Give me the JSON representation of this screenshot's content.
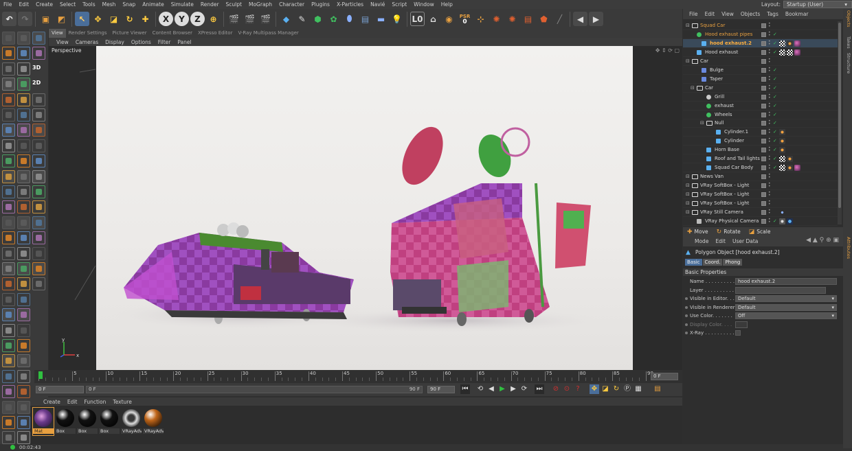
{
  "menubar": {
    "items": [
      "File",
      "Edit",
      "Create",
      "Select",
      "Tools",
      "Mesh",
      "Snap",
      "Animate",
      "Simulate",
      "Render",
      "Sculpt",
      "MoGraph",
      "Character",
      "Plugins",
      "X-Particles",
      "Navié",
      "Script",
      "Window",
      "Help"
    ],
    "layout_label": "Layout:",
    "layout_value": "Startup (User)"
  },
  "toolbar": {
    "axis_labels": [
      "X",
      "Y",
      "Z"
    ],
    "psr_label": "PSR",
    "psr_value": "0",
    "arrow_left": "◀",
    "arrow_right": "▶"
  },
  "left_toolbar": {
    "mode_3d": "3D",
    "mode_2d": "2D"
  },
  "viewport_tabs": [
    "View",
    "Render Settings",
    "Picture Viewer",
    "Content Browser",
    "XPresso Editor",
    "V-Ray Multipass Manager"
  ],
  "viewport_menu": [
    "View",
    "Cameras",
    "Display",
    "Options",
    "Filter",
    "Panel"
  ],
  "viewport": {
    "label": "Perspective",
    "axis_y": "y",
    "axis_x": "x"
  },
  "timeline": {
    "ticks": [
      "0",
      "5",
      "10",
      "15",
      "20",
      "25",
      "30",
      "35",
      "40",
      "45",
      "50",
      "55",
      "60",
      "65",
      "70",
      "75",
      "80",
      "85",
      "90"
    ],
    "current_frame": "0 F",
    "start_field": "0 F",
    "inner_start": "0 F",
    "inner_end": "90 F",
    "end_field": "90 F",
    "playhead_fraction": 0.0
  },
  "material_manager": {
    "menu": [
      "Create",
      "Edit",
      "Function",
      "Texture"
    ],
    "materials": [
      {
        "label": "Mat",
        "color": "#6a3a8a",
        "selected": true
      },
      {
        "label": "Box",
        "color": "#111111",
        "selected": false
      },
      {
        "label": "Box",
        "color": "#111111",
        "selected": false
      },
      {
        "label": "Box",
        "color": "#111111",
        "selected": false
      },
      {
        "label": "VRayAdv",
        "color": "#bbbbbb",
        "selected": false
      },
      {
        "label": "VRayAdv",
        "color": "#c0661a",
        "selected": false
      }
    ]
  },
  "status": {
    "time": "00:02:43"
  },
  "object_manager": {
    "menu": [
      "File",
      "Edit",
      "View",
      "Objects",
      "Tags",
      "Bookmar"
    ],
    "rows": [
      {
        "name": "Squad Car",
        "indent": 0,
        "icon": "null",
        "color": "#e8a040",
        "tags": []
      },
      {
        "name": "Hood exhaust pipes",
        "indent": 1,
        "icon": "green",
        "color": "#e8a040",
        "tags": []
      },
      {
        "name": "hood exhaust.2",
        "indent": 2,
        "icon": "poly",
        "color": "#ffb040",
        "selected": true,
        "tags": [
          "checker",
          "orange",
          "purple"
        ]
      },
      {
        "name": "Hood exhaust",
        "indent": 1,
        "icon": "poly",
        "color": "#d8d8d8",
        "tags": [
          "checker",
          "checker",
          "purple"
        ]
      },
      {
        "name": "Car",
        "indent": 0,
        "icon": "null",
        "color": "#d8d8d8",
        "tags": []
      },
      {
        "name": "Bulge",
        "indent": 2,
        "icon": "deformer",
        "color": "#d8d8d8",
        "tags": []
      },
      {
        "name": "Taper",
        "indent": 2,
        "icon": "deformer",
        "color": "#d8d8d8",
        "tags": []
      },
      {
        "name": "Car",
        "indent": 1,
        "icon": "null",
        "color": "#d8d8d8",
        "tags": []
      },
      {
        "name": "Grill",
        "indent": 3,
        "icon": "gear",
        "color": "#d8d8d8",
        "tags": []
      },
      {
        "name": "exhaust",
        "indent": 3,
        "icon": "green",
        "color": "#d8d8d8",
        "tags": []
      },
      {
        "name": "Wheels",
        "indent": 3,
        "icon": "green",
        "color": "#d8d8d8",
        "tags": []
      },
      {
        "name": "Null",
        "indent": 3,
        "icon": "null",
        "color": "#d8d8d8",
        "tags": []
      },
      {
        "name": "Cylinder.1",
        "indent": 5,
        "icon": "cyl",
        "color": "#d8d8d8",
        "tags": [
          "orange"
        ]
      },
      {
        "name": "Cylinder",
        "indent": 5,
        "icon": "cyl",
        "color": "#d8d8d8",
        "tags": [
          "orange"
        ]
      },
      {
        "name": "Horn Base",
        "indent": 3,
        "icon": "cyl",
        "color": "#d8d8d8",
        "tags": [
          "orange"
        ]
      },
      {
        "name": "Roof and Tail lights",
        "indent": 3,
        "icon": "poly",
        "color": "#d8d8d8",
        "tags": [
          "checker",
          "orange"
        ]
      },
      {
        "name": "Squad Car Body",
        "indent": 3,
        "icon": "poly",
        "color": "#d8d8d8",
        "tags": [
          "checker",
          "orange",
          "purple"
        ]
      },
      {
        "name": "News Van",
        "indent": 0,
        "icon": "null",
        "color": "#d8d8d8",
        "tags": []
      },
      {
        "name": "VRay SoftBox - Light",
        "indent": 0,
        "icon": "null",
        "color": "#d8d8d8",
        "tags": []
      },
      {
        "name": "VRay SoftBox - Light",
        "indent": 0,
        "icon": "null",
        "color": "#d8d8d8",
        "tags": []
      },
      {
        "name": "VRay SoftBox - Light",
        "indent": 0,
        "icon": "null",
        "color": "#d8d8d8",
        "tags": []
      },
      {
        "name": "VRay Still Camera",
        "indent": 0,
        "icon": "null",
        "color": "#d8d8d8",
        "tags": [
          "dots"
        ]
      },
      {
        "name": "VRay Physical Camera",
        "indent": 1,
        "icon": "camera",
        "color": "#d8d8d8",
        "tags": [
          "target",
          "blue"
        ]
      }
    ]
  },
  "side_tabs": [
    "Objects",
    "Takes",
    "Structure",
    "Attributes"
  ],
  "transform_bar": [
    "Move",
    "Rotate",
    "Scale"
  ],
  "attributes": {
    "menu": [
      "Mode",
      "Edit",
      "User Data"
    ],
    "object_title": "Polygon Object [hood exhaust.2]",
    "tabs": [
      "Basic",
      "Coord.",
      "Phong"
    ],
    "section": "Basic Properties",
    "fields": [
      {
        "label": "Name . . . . . . . . . . .",
        "value": "hood exhaust.2",
        "type": "text"
      },
      {
        "label": "Layer . . . . . . . . . . .",
        "value": "",
        "type": "layer"
      },
      {
        "label": "Visible in Editor. . .",
        "value": "Default",
        "type": "dropdown"
      },
      {
        "label": "Visible in Renderer",
        "value": "Default",
        "type": "dropdown"
      },
      {
        "label": "Use Color. . . . . . .",
        "value": "Off",
        "type": "dropdown"
      },
      {
        "label": "Display Color. . . .",
        "value": "",
        "type": "color",
        "dim": true
      },
      {
        "label": "X-Ray . . . . . . . . . .",
        "value": "",
        "type": "check"
      }
    ]
  },
  "colors": {
    "accent_orange": "#e8a040",
    "selection_blue": "#4a6e9a",
    "play_green": "#30c040",
    "record_red": "#d03030"
  }
}
